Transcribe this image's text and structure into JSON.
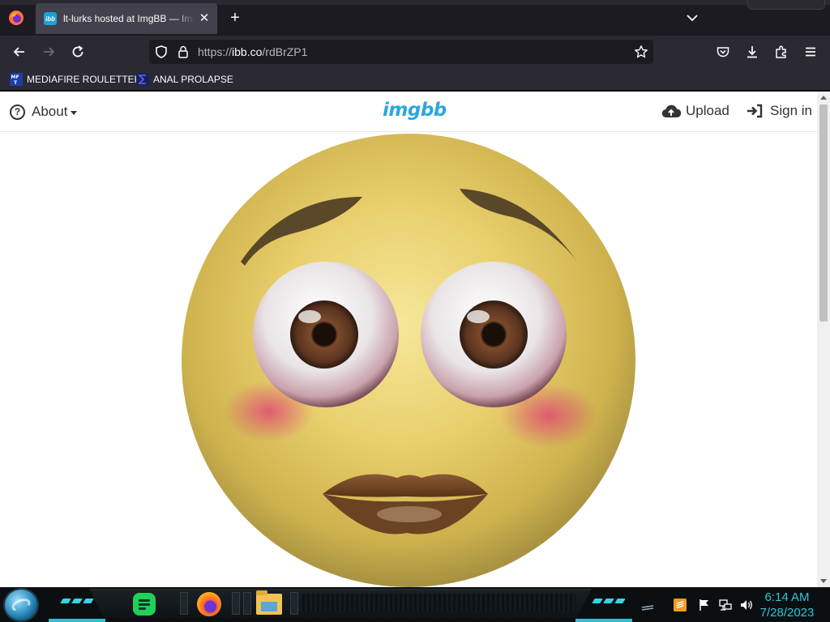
{
  "browser": {
    "tab": {
      "title": "lt-lurks hosted at ImgBB — ImgBB",
      "favicon_text": "ibb"
    },
    "url": {
      "scheme": "https://",
      "host": "ibb.co",
      "path": "/rdBrZP1"
    },
    "bookmarks": [
      {
        "label": "MEDIAFIRE ROULETTER",
        "icon": "mediafire-favicon"
      },
      {
        "label": "ANAL PROLAPSE",
        "icon": "sigma-favicon"
      }
    ]
  },
  "site": {
    "nav": {
      "about_label": "About",
      "logo_text": "imgbb",
      "upload_label": "Upload",
      "signin_label": "Sign in"
    },
    "image": {
      "subject": "yellow emoji face with realistic eyes, eyebrows and lips"
    }
  },
  "taskbar": {
    "apps": [
      "notepad",
      "firefox",
      "file-explorer"
    ],
    "tray_icons": [
      "show-desktop-icon",
      "sublime-icon",
      "flag-icon",
      "network-icon",
      "volume-icon"
    ],
    "clock": {
      "time": "6:14 AM",
      "date": "7/28/2023"
    }
  },
  "colors": {
    "browser_dark": "#1c1b22",
    "browser_toolbar": "#2b2a33",
    "imgbb_blue": "#2ba7de",
    "taskbar_cyan": "#29c9d6",
    "emoji_yellow": "#e7cd6a"
  }
}
